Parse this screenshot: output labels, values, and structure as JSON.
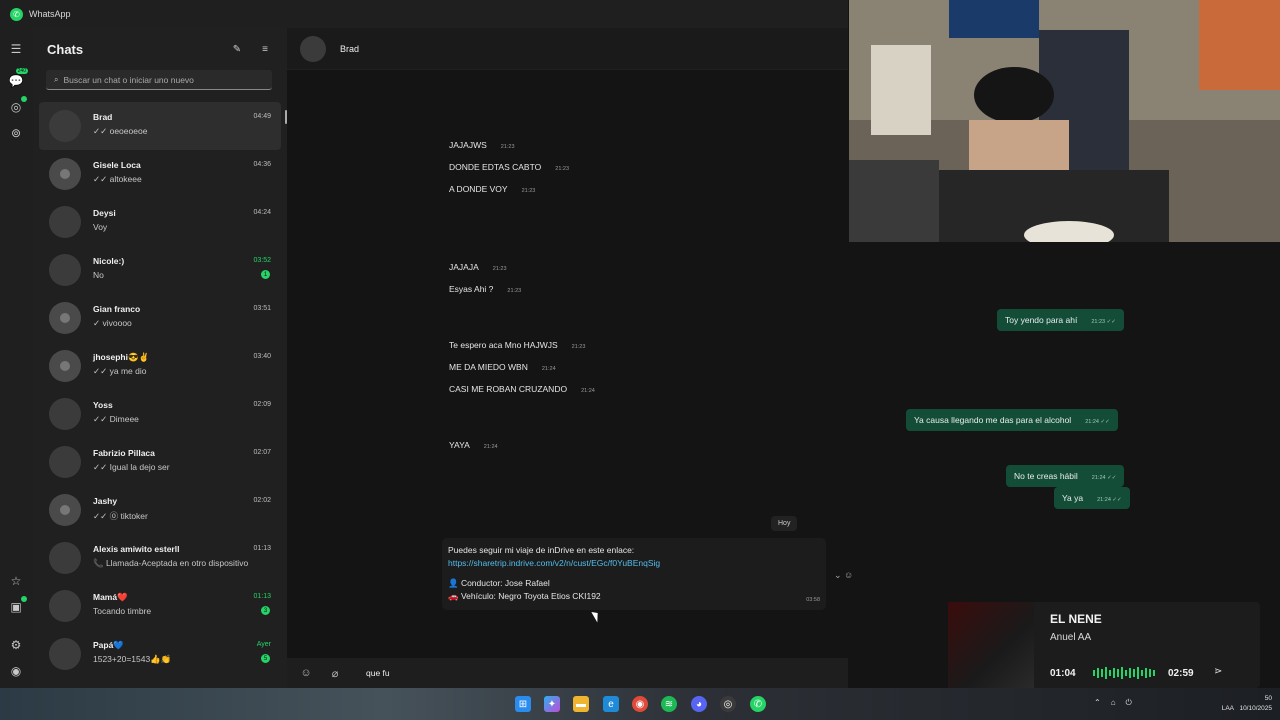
{
  "app": {
    "title": "WhatsApp"
  },
  "rail": {
    "chats_badge": "240"
  },
  "chatlist": {
    "heading": "Chats",
    "search_placeholder": "Buscar un chat o iniciar uno nuevo",
    "chats": [
      {
        "name": "Brad",
        "preview": "✓✓ oeoeoeoe",
        "time": "04:49",
        "active": true
      },
      {
        "name": "Gisele Loca",
        "preview": "✓✓ altokeee",
        "time": "04:36"
      },
      {
        "name": "Deysi",
        "preview": "Voy",
        "time": "04:24"
      },
      {
        "name": "Nicole:)",
        "preview": "No",
        "time": "03:52",
        "unread": "1"
      },
      {
        "name": "Gian franco",
        "preview": "✓ vivoooo",
        "time": "03:51"
      },
      {
        "name": "jhosephi😎✌️",
        "preview": "✓✓ ya me dio",
        "time": "03:40"
      },
      {
        "name": "Yoss",
        "preview": "✓✓ Dimeee",
        "time": "02:09"
      },
      {
        "name": "Fabrizio Pillaca",
        "preview": "✓✓ Igual la dejo ser",
        "time": "02:07"
      },
      {
        "name": "Jashy",
        "preview": "✓✓ ⓪ tiktoker",
        "time": "02:02"
      },
      {
        "name": "Alexis amiwito esterll",
        "preview": "📞 Llamada-Aceptada en otro dispositivo",
        "time": "01:13"
      },
      {
        "name": "Mamá❤️",
        "preview": "Tocando timbre",
        "time": "01:13",
        "unread": "3"
      },
      {
        "name": "Papá💙",
        "preview": "1523+20=1543👍👏",
        "time": "Ayer",
        "unread": "5"
      }
    ]
  },
  "conversation": {
    "contact": "Brad",
    "incoming": [
      {
        "text": "JAJAJWS",
        "time": "21:23"
      },
      {
        "text": "DONDE EDTAS CABTO",
        "time": "21:23"
      },
      {
        "text": "A DONDE VOY",
        "time": "21:23"
      },
      {
        "text": "JAJAJA",
        "time": "21:23"
      },
      {
        "text": "Esyas Ahi ?",
        "time": "21:23"
      },
      {
        "text": "Te espero aca Mno HAJWJS",
        "time": "21:23"
      },
      {
        "text": "ME DA MIEDO WBN",
        "time": "21:24"
      },
      {
        "text": "CASI ME ROBAN CRUZANDO",
        "time": "21:24"
      },
      {
        "text": "YAYA",
        "time": "21:24"
      }
    ],
    "outgoing": [
      {
        "text": "Toy yendo para ahí",
        "time": "21:23 ✓✓"
      },
      {
        "text": "Ya causa llegando me das para el alcohol",
        "time": "21:24 ✓✓"
      },
      {
        "text": "No te creas hábil",
        "time": "21:24 ✓✓"
      },
      {
        "text": "Ya ya",
        "time": "21:24 ✓✓"
      }
    ],
    "day_separator": "Hoy",
    "link_message": {
      "intro": "Puedes seguir mi viaje de inDrive en este enlace: ",
      "link": "https://sharetrip.indrive.com/v2/n/cust/EGc/f0YuBEnqSig",
      "driver": "👤 Conductor: Jose Rafael",
      "vehicle": "🚗 Vehículo: Negro Toyota Etios CKI192",
      "time": "03:58"
    },
    "composer_text": "que fu"
  },
  "music": {
    "title": "EL NENE",
    "artist": "Anuel AA",
    "current": "01:04",
    "total": "02:59"
  },
  "tray": {
    "lang": "LAA",
    "time": "50",
    "date": "10/10/2025"
  },
  "colors": {
    "accent": "#25d366",
    "outgoing_bubble": "#134d37",
    "link": "#53bdeb"
  }
}
